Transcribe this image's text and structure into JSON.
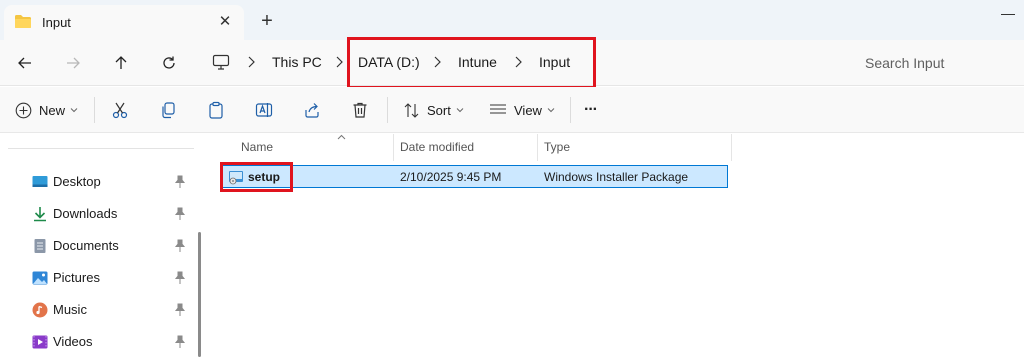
{
  "window": {
    "tab_title": "Input",
    "tab_close": "✕",
    "new_tab": "+"
  },
  "address": {
    "crumbs": [
      "This PC",
      "DATA (D:)",
      "Intune",
      "Input"
    ],
    "search_placeholder": "Search Input"
  },
  "commands": {
    "new_label": "New",
    "sort_label": "Sort",
    "view_label": "View",
    "more_label": "···"
  },
  "sidebar": {
    "items": [
      {
        "label": "Desktop",
        "icon": "desktop-icon"
      },
      {
        "label": "Downloads",
        "icon": "downloads-icon"
      },
      {
        "label": "Documents",
        "icon": "documents-icon"
      },
      {
        "label": "Pictures",
        "icon": "pictures-icon"
      },
      {
        "label": "Music",
        "icon": "music-icon"
      },
      {
        "label": "Videos",
        "icon": "videos-icon"
      }
    ]
  },
  "files": {
    "columns": [
      "Name",
      "Date modified",
      "Type"
    ],
    "rows": [
      {
        "name": "setup",
        "date": "2/10/2025 9:45 PM",
        "type": "Windows Installer Package",
        "selected": true
      }
    ]
  },
  "colors": {
    "accent": "#0078d4",
    "selection": "#cce8ff",
    "highlight_box": "#e0141e"
  }
}
